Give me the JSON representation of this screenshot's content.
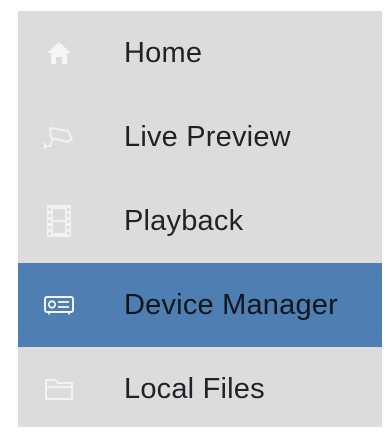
{
  "menu": {
    "items": [
      {
        "label": "Home",
        "icon": "home-icon",
        "active": false
      },
      {
        "label": "Live Preview",
        "icon": "camera-icon",
        "active": false
      },
      {
        "label": "Playback",
        "icon": "film-icon",
        "active": false
      },
      {
        "label": "Device Manager",
        "icon": "device-icon",
        "active": true
      },
      {
        "label": "Local Files",
        "icon": "folder-icon",
        "active": false
      }
    ]
  },
  "colors": {
    "menu_background": "#dcdcdc",
    "active_background": "#4f7fb2",
    "icon_light": "#f5f5f5",
    "text": "#1f2327"
  }
}
